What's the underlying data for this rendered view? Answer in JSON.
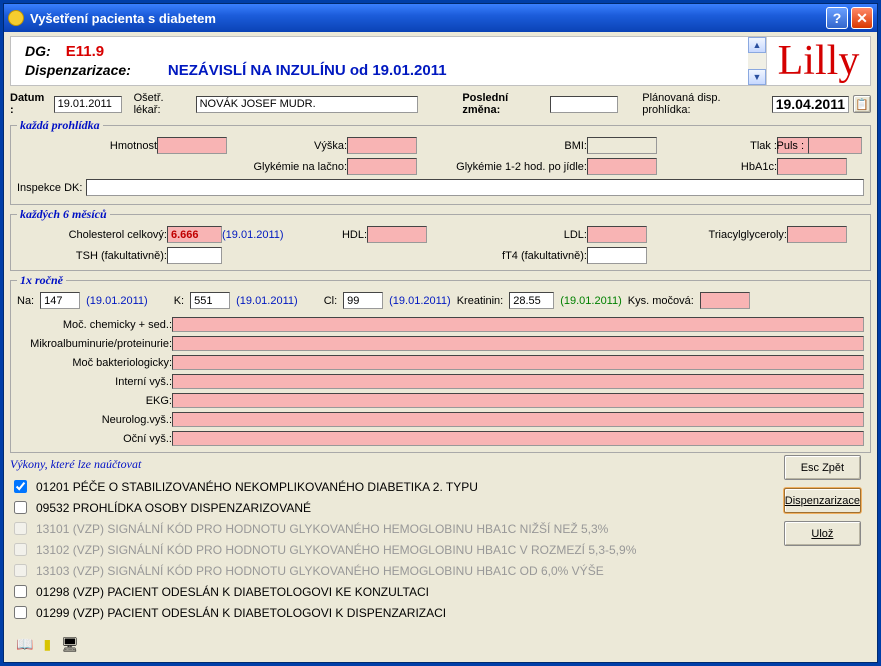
{
  "window": {
    "title": "Vyšetření pacienta s diabetem"
  },
  "banner": {
    "dg_label": "DG:",
    "dg_value": "E11.9",
    "disp_label": "Dispenzarizace:",
    "disp_value": "NEZÁVISLÍ NA INZULÍNU od 19.01.2011",
    "logo": "Lilly"
  },
  "header": {
    "date_label": "Datum :",
    "date_value": "19.01.2011",
    "doctor_label": "Ošetř. lékař:",
    "doctor_value": "NOVÁK JOSEF MUDR.",
    "last_change_label": "Poslední změna:",
    "last_change_value": "",
    "planned_label": "Plánovaná disp. prohlídka:",
    "planned_value": "19.04.2011"
  },
  "sections": {
    "every_visit": {
      "legend": "každá prohlídka",
      "weight": "Hmotnost",
      "height": "Výška:",
      "bmi": "BMI:",
      "bp": "Tlak :",
      "pulse": "Puls :",
      "glyk_fast": "Glykémie na lačno:",
      "glyk_post": "Glykémie 1-2 hod. po jídle:",
      "hba1c": "HbA1c:",
      "inspekce": "Inspekce DK:"
    },
    "six_months": {
      "legend": "každých 6 měsíců",
      "chol_label": "Cholesterol celkový:",
      "chol_value": "6.666",
      "chol_date": "(19.01.2011)",
      "hdl": "HDL:",
      "ldl": "LDL:",
      "tg": "Triacylglyceroly:",
      "tsh": "TSH (fakultativně):",
      "ft4": "fT4 (fakultativně):"
    },
    "yearly": {
      "legend": "1x ročně",
      "na_label": "Na:",
      "na_value": "147",
      "na_date": "(19.01.2011)",
      "k_label": "K:",
      "k_value": "551",
      "k_date": "(19.01.2011)",
      "cl_label": "Cl:",
      "cl_value": "99",
      "cl_date": "(19.01.2011)",
      "creat_label": "Kreatinin:",
      "creat_value": "28.55",
      "creat_date": "(19.01.2011)",
      "kys_label": "Kys. močová:",
      "rows": {
        "r1": "Moč. chemicky + sed.:",
        "r2": "Mikroalbuminurie/proteinurie:",
        "r3": "Moč bakteriologicky:",
        "r4": "Interní vyš.:",
        "r5": "EKG:",
        "r6": "Neurolog.vyš.:",
        "r7": "Oční vyš.:"
      }
    }
  },
  "procedures": {
    "legend": "Výkony, které lze naúčtovat",
    "items": [
      {
        "checked": true,
        "enabled": true,
        "text": "01201 PÉČE O STABILIZOVANÉHO NEKOMPLIKOVANÉHO DIABETIKA 2. TYPU"
      },
      {
        "checked": false,
        "enabled": true,
        "text": "09532 PROHLÍDKA OSOBY DISPENZARIZOVANÉ"
      },
      {
        "checked": false,
        "enabled": false,
        "text": "13101 (VZP) SIGNÁLNÍ KÓD PRO HODNOTU GLYKOVANÉHO HEMOGLOBINU HBA1C NIŽŠÍ NEŽ 5,3%"
      },
      {
        "checked": false,
        "enabled": false,
        "text": "13102 (VZP) SIGNÁLNÍ KÓD PRO HODNOTU GLYKOVANÉHO HEMOGLOBINU HBA1C V ROZMEZÍ 5,3-5,9%"
      },
      {
        "checked": false,
        "enabled": false,
        "text": "13103 (VZP) SIGNÁLNÍ KÓD PRO HODNOTU GLYKOVANÉHO HEMOGLOBINU HBA1C OD 6,0% VÝŠE"
      },
      {
        "checked": false,
        "enabled": true,
        "text": "01298 (VZP) PACIENT ODESLÁN K DIABETOLOGOVI KE KONZULTACI"
      },
      {
        "checked": false,
        "enabled": true,
        "text": "01299 (VZP) PACIENT ODESLÁN K DIABETOLOGOVI K DISPENZARIZACI"
      }
    ]
  },
  "buttons": {
    "esc": "Esc Zpět",
    "disp": "Dispenzarizace",
    "save": "Ulož"
  }
}
